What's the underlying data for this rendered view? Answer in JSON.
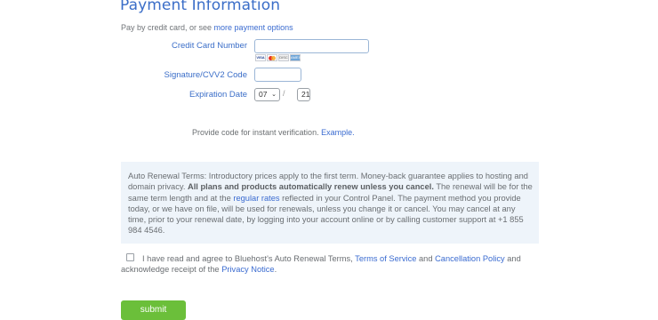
{
  "header": {
    "title": "Payment Information",
    "subtitle_prefix": "Pay by credit card, or see ",
    "subtitle_link": "more payment options"
  },
  "form": {
    "cc_label": "Credit Card Number",
    "cc_value": "",
    "cvv_label": "Signature/CVV2 Code",
    "cvv_value": "",
    "exp_label": "Expiration Date",
    "exp_month": "07",
    "exp_year": "21",
    "cards": [
      {
        "name": "visa-icon",
        "text": "VISA"
      },
      {
        "name": "mastercard-icon",
        "text": ""
      },
      {
        "name": "discover-icon",
        "text": "DISC"
      },
      {
        "name": "amex-icon",
        "text": "AMEX"
      }
    ]
  },
  "instant": {
    "text": "Provide code for instant verification. ",
    "link": "Example."
  },
  "terms": {
    "p1": "Auto Renewal Terms: Introductory prices apply to the first term. Money-back guarantee applies to hosting and domain privacy. ",
    "bold": "All plans and products automatically renew unless you cancel.",
    "p2": " The renewal will be for the same term length and at the ",
    "link": "regular rates",
    "p3": " reflected in your Control Panel. The payment method you provide today, or we have on file, will be used for renewals, unless you change it or cancel. You may cancel at any time, prior to your renewal date, by logging into your account online or by calling customer support at +1 855 984 4546."
  },
  "agree": {
    "prefix": "I have read and agree to Bluehost's Auto Renewal Terms, ",
    "tos": "Terms of Service",
    "and": " and ",
    "cancel": "Cancellation Policy",
    "mid": " and acknowledge receipt of the ",
    "privacy": "Privacy Notice",
    "end": ".",
    "checked": false
  },
  "submit": {
    "label": "submit"
  },
  "colors": {
    "accent": "#3b6ec8",
    "submit": "#6bbf3a",
    "terms_bg": "#eef4fa"
  }
}
